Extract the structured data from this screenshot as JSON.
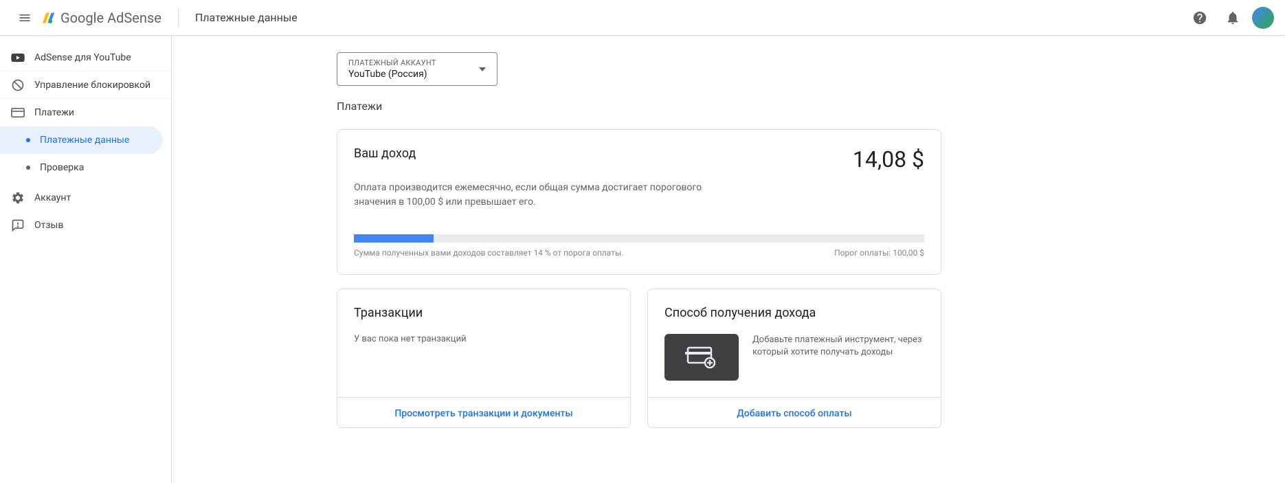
{
  "header": {
    "brand_text": "Google AdSense",
    "page_title": "Платежные данные"
  },
  "sidebar": {
    "items": [
      {
        "label": "AdSense для YouTube"
      },
      {
        "label": "Управление блокировкой"
      },
      {
        "label": "Платежи"
      },
      {
        "label": "Аккаунт"
      },
      {
        "label": "Отзыв"
      }
    ],
    "sub_items": [
      {
        "label": "Платежные данные"
      },
      {
        "label": "Проверка"
      }
    ]
  },
  "account_selector": {
    "label": "ПЛАТЕЖНЫЙ АККАУНТ",
    "value": "YouTube (Россия)"
  },
  "section_heading": "Платежи",
  "earnings": {
    "title": "Ваш доход",
    "amount": "14,08 $",
    "description": "Оплата производится ежемесячно, если общая сумма достигает порогового значения в 100,00 $ или превышает его.",
    "progress_percent": 14,
    "progress_text": "Сумма полученных вами доходов составляет 14 % от порога оплаты.",
    "threshold_text": "Порог оплаты: 100,00 $"
  },
  "transactions": {
    "title": "Транзакции",
    "empty_text": "У вас пока нет транзакций",
    "link": "Просмотреть транзакции и документы"
  },
  "payment_method": {
    "title": "Способ получения дохода",
    "description": "Добавьте платежный инструмент, через который хотите получать доходы",
    "link": "Добавить способ оплаты"
  }
}
